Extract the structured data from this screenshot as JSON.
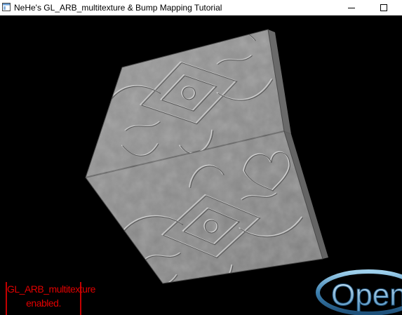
{
  "window": {
    "title": "NeHe's GL_ARB_multitexture & Bump Mapping Tutorial",
    "icon": "app-window-icon",
    "controls": [
      "minimize-icon",
      "maximize-icon"
    ]
  },
  "viewport": {
    "background": "#000000",
    "status": {
      "line1": "GL_ARB_multitexture",
      "line2": "enabled.",
      "color": "#e00000"
    },
    "logo": {
      "text": "OpenG",
      "color": "#5a9ac0"
    },
    "cube": {
      "texture": "embossed-floral-bump-map",
      "color": "#8c8c8c"
    }
  }
}
